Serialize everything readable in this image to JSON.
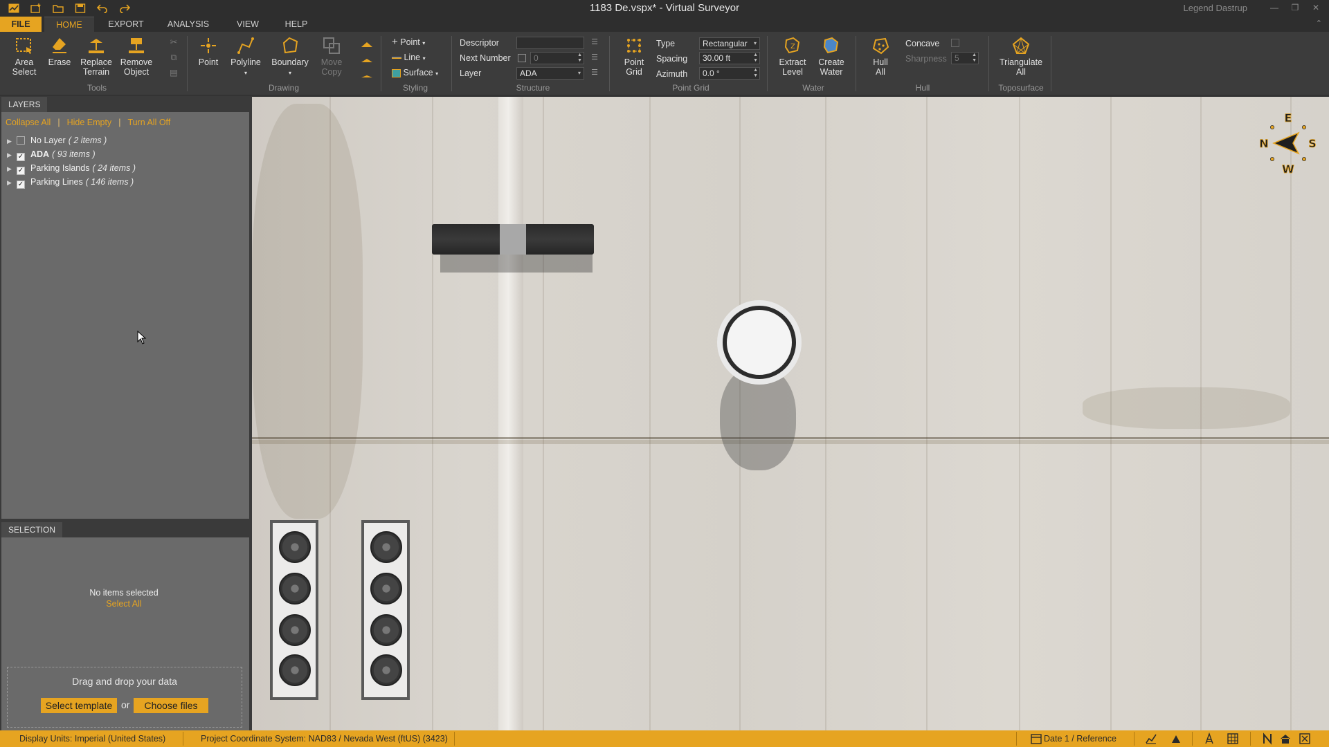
{
  "titlebar": {
    "title": "1183 De.vspx*  -  Virtual Surveyor",
    "user": "Legend Dastrup",
    "icons": [
      "app-icon",
      "new-icon",
      "open-icon",
      "save-icon",
      "undo-icon",
      "redo-icon"
    ]
  },
  "menu": {
    "file": "FILE",
    "home": "HOME",
    "export": "EXPORT",
    "analysis": "ANALYSIS",
    "view": "VIEW",
    "help": "HELP"
  },
  "ribbon": {
    "tools": {
      "area_select": [
        "Area",
        "Select"
      ],
      "erase": "Erase",
      "replace_terrain": [
        "Replace",
        "Terrain"
      ],
      "remove_object": [
        "Remove",
        "Object"
      ],
      "label": "Tools"
    },
    "drawing": {
      "point": "Point",
      "polyline": "Polyline",
      "boundary": "Boundary",
      "move_copy": [
        "Move",
        "Copy"
      ],
      "label": "Drawing"
    },
    "styling": {
      "point": "Point",
      "line": "Line",
      "surface": "Surface",
      "label": "Styling"
    },
    "structure": {
      "descriptor_label": "Descriptor",
      "descriptor_value": "",
      "next_number_label": "Next Number",
      "next_number_value": "0",
      "layer_label": "Layer",
      "layer_value": "ADA",
      "label": "Structure"
    },
    "point_grid": {
      "button": [
        "Point",
        "Grid"
      ],
      "type_label": "Type",
      "type_value": "Rectangular",
      "spacing_label": "Spacing",
      "spacing_value": "30.00 ft",
      "azimuth_label": "Azimuth",
      "azimuth_value": "0.0 °",
      "label": "Point Grid"
    },
    "water": {
      "extract_level": [
        "Extract",
        "Level"
      ],
      "create_water": [
        "Create",
        "Water"
      ],
      "label": "Water"
    },
    "hull": {
      "hull_all": [
        "Hull",
        "All"
      ],
      "concave_label": "Concave",
      "sharpness_label": "Sharpness",
      "sharpness_value": "5",
      "label": "Hull"
    },
    "toposurface": {
      "triangulate_all": [
        "Triangulate",
        "All"
      ],
      "label": "Toposurface"
    }
  },
  "layers": {
    "tab": "LAYERS",
    "collapse_all": "Collapse All",
    "hide_empty": "Hide Empty",
    "turn_all_off": "Turn All Off",
    "items": [
      {
        "name": "No Layer",
        "count": "( 2 items )",
        "checked": false,
        "bold": false
      },
      {
        "name": "ADA",
        "count": "( 93 items )",
        "checked": true,
        "bold": true
      },
      {
        "name": "Parking Islands",
        "count": "( 24 items )",
        "checked": true,
        "bold": false
      },
      {
        "name": "Parking Lines",
        "count": "( 146 items )",
        "checked": true,
        "bold": false
      }
    ]
  },
  "selection": {
    "tab": "SELECTION",
    "empty_text": "No items selected",
    "select_all": "Select All"
  },
  "dropzone": {
    "text": "Drag and drop your data",
    "select_template": "Select template",
    "or": "or",
    "choose_files": "Choose files"
  },
  "compass": {
    "n": "N",
    "e": "E",
    "s": "S",
    "w": "W"
  },
  "status": {
    "display_units": "Display Units:  Imperial (United States)",
    "coord_system": "Project Coordinate System:  NAD83 / Nevada West (ftUS) (3423)",
    "date_ref": "Date 1 / Reference"
  },
  "colors": {
    "accent": "#e6a421",
    "panel": "#6a6a6a",
    "ribbon": "#3c3c3c",
    "titlebar": "#2e2e2e"
  }
}
